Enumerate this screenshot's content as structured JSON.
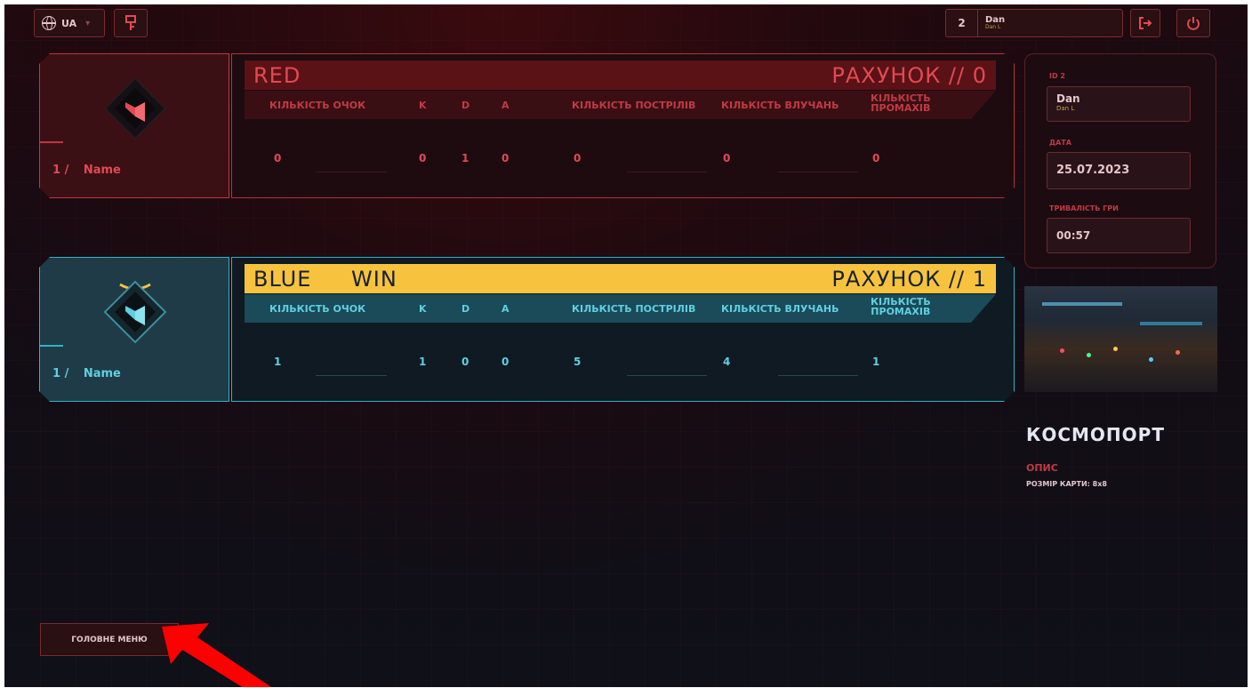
{
  "topbar": {
    "language": "UA",
    "user_level": "2",
    "user_name": "Dan",
    "user_sub": "Dan L"
  },
  "teams": {
    "red": {
      "name": "RED",
      "status": "",
      "score_label": "РАХУНОК // 0",
      "player_num": "1 /",
      "player_name": "Name",
      "headers": {
        "points": "КІЛЬКІСТЬ ОЧОК",
        "k": "K",
        "d": "D",
        "a": "A",
        "shots": "КІЛЬКІСТЬ ПОСТРІЛІВ",
        "hits": "КІЛЬКІСТЬ ВЛУЧАНЬ",
        "misses_1": "КІЛЬКІСТЬ",
        "misses_2": "ПРОМАХІВ"
      },
      "values": {
        "points": "0",
        "k": "0",
        "d": "1",
        "a": "0",
        "shots": "0",
        "hits": "0",
        "misses": "0"
      },
      "color": "#e24a52"
    },
    "blue": {
      "name": "BLUE",
      "status": "WIN",
      "score_label": "РАХУНОК // 1",
      "player_num": "1 /",
      "player_name": "Name",
      "headers": {
        "points": "КІЛЬКІСТЬ ОЧОК",
        "k": "K",
        "d": "D",
        "a": "A",
        "shots": "КІЛЬКІСТЬ ПОСТРІЛІВ",
        "hits": "КІЛЬКІСТЬ ВЛУЧАНЬ",
        "misses_1": "КІЛЬКІСТЬ",
        "misses_2": "ПРОМАХІВ"
      },
      "values": {
        "points": "1",
        "k": "1",
        "d": "0",
        "a": "0",
        "shots": "5",
        "hits": "4",
        "misses": "1"
      },
      "color": "#5fd0e2"
    }
  },
  "info": {
    "id_label": "ID 2",
    "user_name": "Dan",
    "user_sub": "Dan L",
    "date_label": "ДАТА",
    "date": "25.07.2023",
    "duration_label": "ТРИВАЛІСТЬ ГРИ",
    "duration": "00:57"
  },
  "map": {
    "title": "КОСМОПОРТ",
    "desc_label": "ОПИС",
    "size": "РОЗМІР КАРТИ: 8x8"
  },
  "footer": {
    "main_menu": "ГОЛОВНЕ МЕНЮ"
  },
  "icons": {
    "language": "globe-icon",
    "key": "key-icon",
    "exit": "exit-icon",
    "power": "power-icon"
  }
}
